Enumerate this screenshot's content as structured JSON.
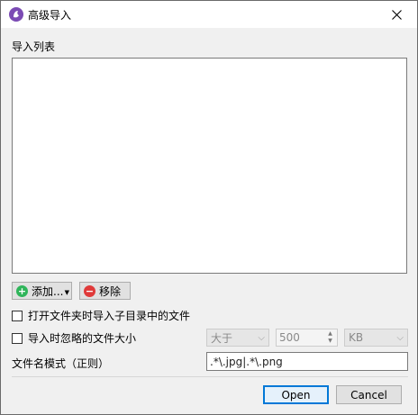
{
  "window": {
    "title": "高级导入",
    "close_glyph": "✕"
  },
  "import_list": {
    "label": "导入列表",
    "items": []
  },
  "buttons": {
    "add_label": "添加...",
    "add_icon": "plus-circle-icon",
    "remove_label": "移除",
    "remove_icon": "minus-circle-icon",
    "open_label": "Open",
    "cancel_label": "Cancel"
  },
  "options": {
    "include_subdirs_label": "打开文件夹时导入子目录中的文件",
    "include_subdirs_checked": false,
    "ignore_size_label": "导入时忽略的文件大小",
    "ignore_size_checked": false,
    "size_compare_value": "大于",
    "size_value": "500",
    "size_unit": "KB"
  },
  "pattern": {
    "label": "文件名模式（正则）",
    "value": ".*\\.jpg|.*\\.png"
  },
  "colors": {
    "app_icon": "#7b4bb4",
    "add_icon": "#2fb55a",
    "remove_icon": "#e03a3a",
    "default_button_border": "#0078d7"
  }
}
